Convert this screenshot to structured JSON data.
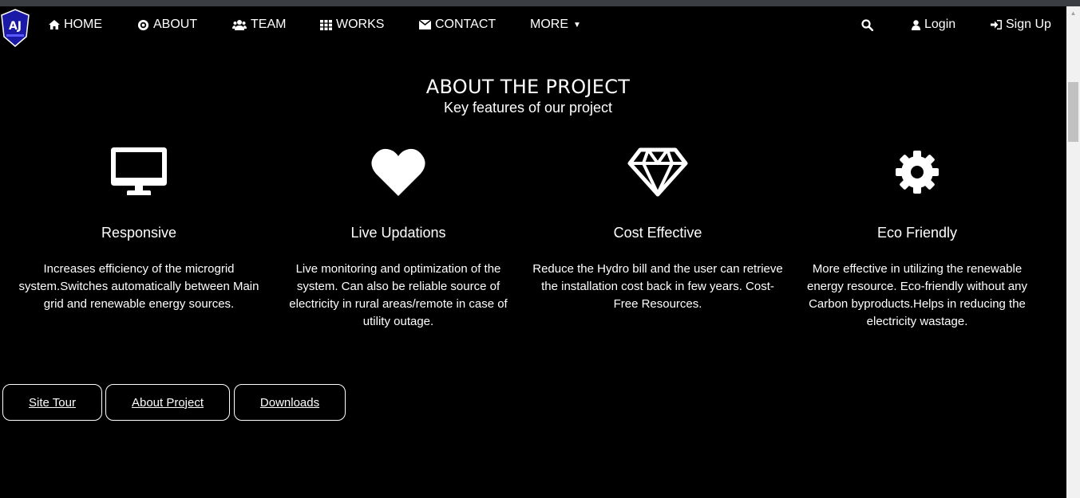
{
  "brand": {
    "logo_text": "AJ"
  },
  "nav": {
    "home": "HOME",
    "about": "ABOUT",
    "team": "TEAM",
    "works": "WORKS",
    "contact": "CONTACT",
    "more": "MORE",
    "login": "Login",
    "signup": "Sign Up"
  },
  "about": {
    "title": "ABOUT THE PROJECT",
    "subtitle": "Key features of our project"
  },
  "features": [
    {
      "icon": "desktop-icon",
      "title": "Responsive",
      "text": "Increases efficiency of the microgrid system.Switches automatically between Main grid and renewable energy sources."
    },
    {
      "icon": "heart-icon",
      "title": "Live Updations",
      "text": "Live monitoring and optimization of the system. Can also be reliable source of electricity in rural areas/remote in case of utility outage."
    },
    {
      "icon": "diamond-icon",
      "title": "Cost Effective",
      "text": "Reduce the Hydro bill and the user can retrieve the installation cost back in few years. Cost-Free Resources."
    },
    {
      "icon": "gear-icon",
      "title": "Eco Friendly",
      "text": "More effective in utilizing the renewable energy resource. Eco-friendly without any Carbon byproducts.Helps in reducing the electricity wastage."
    }
  ],
  "buttons": {
    "site_tour": "Site Tour",
    "about_project": "About Project",
    "downloads": "Downloads"
  },
  "colors": {
    "background": "#000000",
    "text": "#ffffff",
    "logo": "#1a1aa6"
  }
}
